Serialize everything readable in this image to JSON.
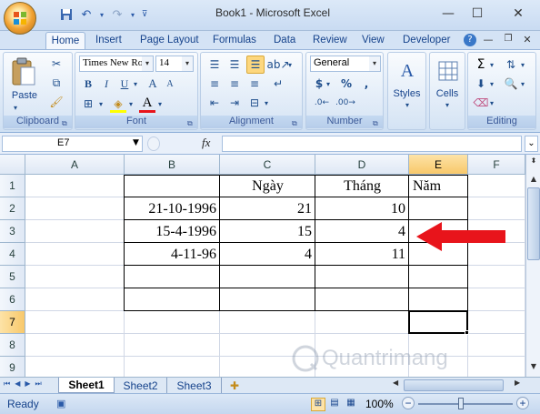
{
  "window": {
    "title": "Book1 - Microsoft Excel",
    "minimize": "—",
    "maximize": "☐",
    "close": "✕"
  },
  "tabs": [
    "Home",
    "Insert",
    "Page Layout",
    "Formulas",
    "Data",
    "Review",
    "View",
    "Developer"
  ],
  "ribbon": {
    "clipboard": {
      "label": "Clipboard",
      "paste": "Paste"
    },
    "font": {
      "label": "Font",
      "family": "Times New Ro",
      "size": "14",
      "bold": "B",
      "italic": "I",
      "underline": "U",
      "grow": "A",
      "shrink": "A",
      "font_color_glyph": "A"
    },
    "alignment": {
      "label": "Alignment"
    },
    "number": {
      "label": "Number",
      "format": "General",
      "currency": "$",
      "percent": "%",
      "comma": ","
    },
    "styles": {
      "label": "Styles"
    },
    "cells": {
      "label": "Cells"
    },
    "editing": {
      "label": "Editing",
      "sum": "Σ"
    }
  },
  "formula_bar": {
    "name_box": "E7",
    "fx": "fx",
    "formula": ""
  },
  "columns": [
    "A",
    "B",
    "C",
    "D",
    "E",
    "F"
  ],
  "rows": [
    "1",
    "2",
    "3",
    "4",
    "5",
    "6",
    "7",
    "8",
    "9"
  ],
  "cells": {
    "C1": "Ngày",
    "D1": "Tháng",
    "E1": "Năm",
    "B2": "21-10-1996",
    "C2": "21",
    "D2": "10",
    "B3": "15-4-1996",
    "C3": "15",
    "D3": "4",
    "B4": "4-11-96",
    "C4": "4",
    "D4": "11"
  },
  "selected_cell": "E7",
  "sheets": [
    "Sheet1",
    "Sheet2",
    "Sheet3"
  ],
  "active_sheet": "Sheet1",
  "status": {
    "mode": "Ready",
    "zoom": "100%",
    "zoom_minus": "−",
    "zoom_plus": "+"
  },
  "watermark": "Quantrimang",
  "colors": {
    "arrow": "#e8141b",
    "selected_header": "#f8c86a",
    "ribbon": "#dce8f6"
  }
}
